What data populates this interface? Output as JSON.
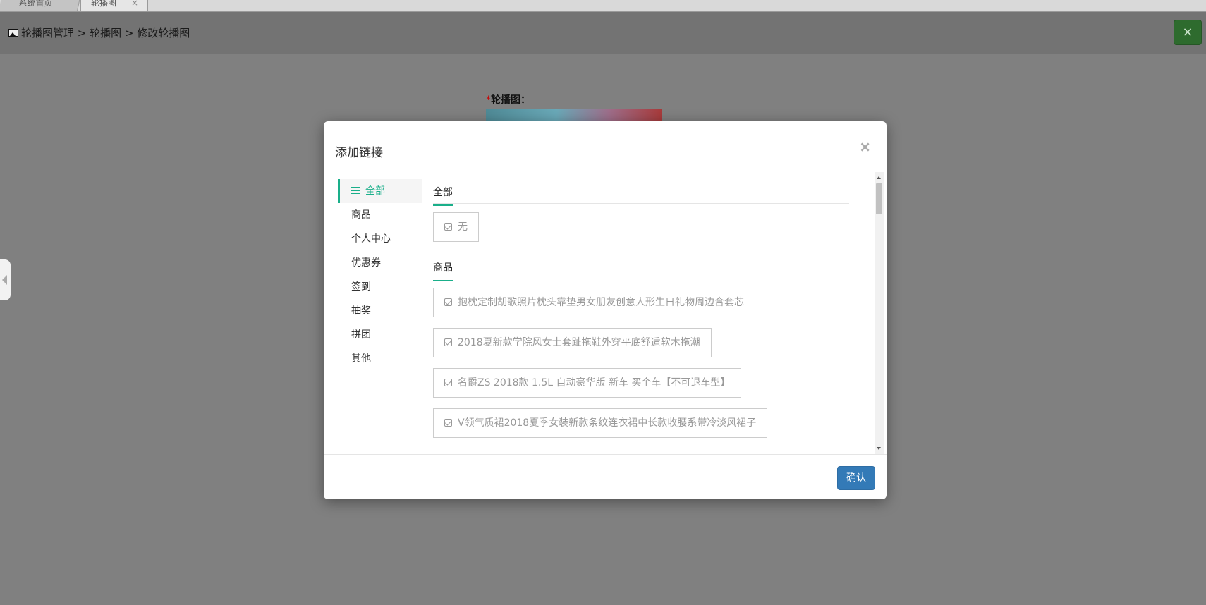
{
  "tabs": [
    {
      "label": "系统首页"
    },
    {
      "label": "轮播图",
      "close": "×"
    }
  ],
  "breadcrumb": {
    "icon": "image-icon",
    "text": "轮播图管理 > 轮播图 > 修改轮播图"
  },
  "top_close": "×",
  "form": {
    "required_mark": "*",
    "label": "轮播图："
  },
  "modal": {
    "title": "添加链接",
    "close": "×",
    "nav": [
      {
        "label": "全部",
        "active": true
      },
      {
        "label": "商品"
      },
      {
        "label": "个人中心"
      },
      {
        "label": "优惠券"
      },
      {
        "label": "签到"
      },
      {
        "label": "抽奖"
      },
      {
        "label": "拼团"
      },
      {
        "label": "其他"
      }
    ],
    "sections": [
      {
        "title": "全部",
        "items": [
          "无"
        ]
      },
      {
        "title": "商品",
        "items": [
          "抱枕定制胡歌照片枕头靠垫男女朋友创意人形生日礼物周边含套芯",
          "2018夏新款学院风女士套趾拖鞋外穿平底舒适软木拖潮",
          "名爵ZS 2018款 1.5L 自动豪华版 新车 买个车【不可退车型】",
          "V领气质裙2018夏季女装新款条纹连衣裙中长款收腰系带冷淡风裙子"
        ]
      }
    ],
    "confirm_label": "确认"
  },
  "colors": {
    "accent": "#1aaf8a",
    "primary": "#337ab7",
    "overlay": "#808080",
    "close_green": "#2e6b2e"
  }
}
